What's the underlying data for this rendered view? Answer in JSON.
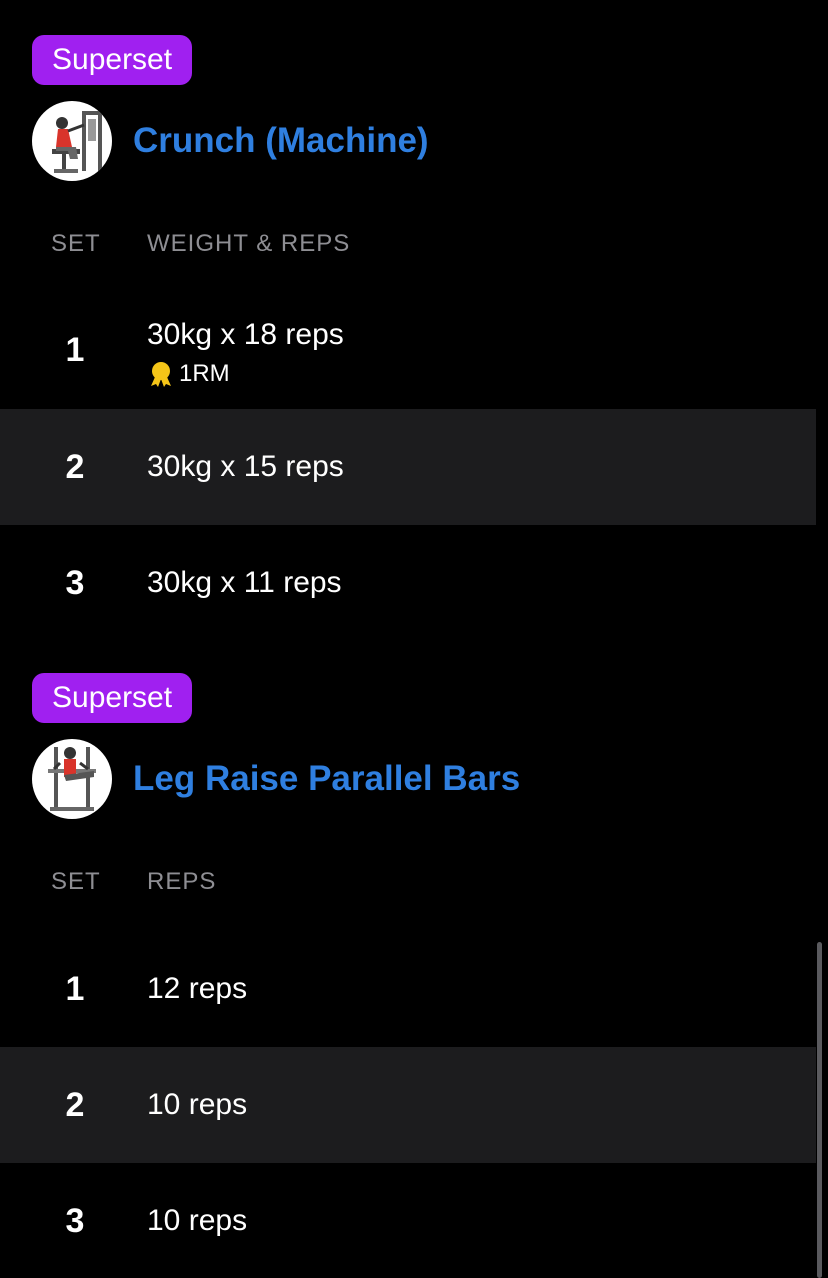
{
  "exercises": [
    {
      "badge": "Superset",
      "title": "Crunch (Machine)",
      "thumbnail_icon": "crunch-machine-illustration",
      "columns": {
        "set": "SET",
        "value": "WEIGHT & REPS"
      },
      "sets": [
        {
          "num": "1",
          "value": "30kg x 18 reps",
          "pr_label": "1RM",
          "pr_icon": "medal-icon"
        },
        {
          "num": "2",
          "value": "30kg x 15 reps"
        },
        {
          "num": "3",
          "value": "30kg x 11 reps"
        }
      ]
    },
    {
      "badge": "Superset",
      "title": "Leg Raise Parallel Bars",
      "thumbnail_icon": "leg-raise-illustration",
      "columns": {
        "set": "SET",
        "value": "REPS"
      },
      "sets": [
        {
          "num": "1",
          "value": "12 reps"
        },
        {
          "num": "2",
          "value": "10 reps"
        },
        {
          "num": "3",
          "value": "10 reps"
        }
      ]
    }
  ],
  "colors": {
    "background": "#000000",
    "badge": "#a020f0",
    "title": "#2f7fe0",
    "header_text": "#8e8e93",
    "alt_row": "#1c1c1e",
    "medal": "#f5c518"
  }
}
